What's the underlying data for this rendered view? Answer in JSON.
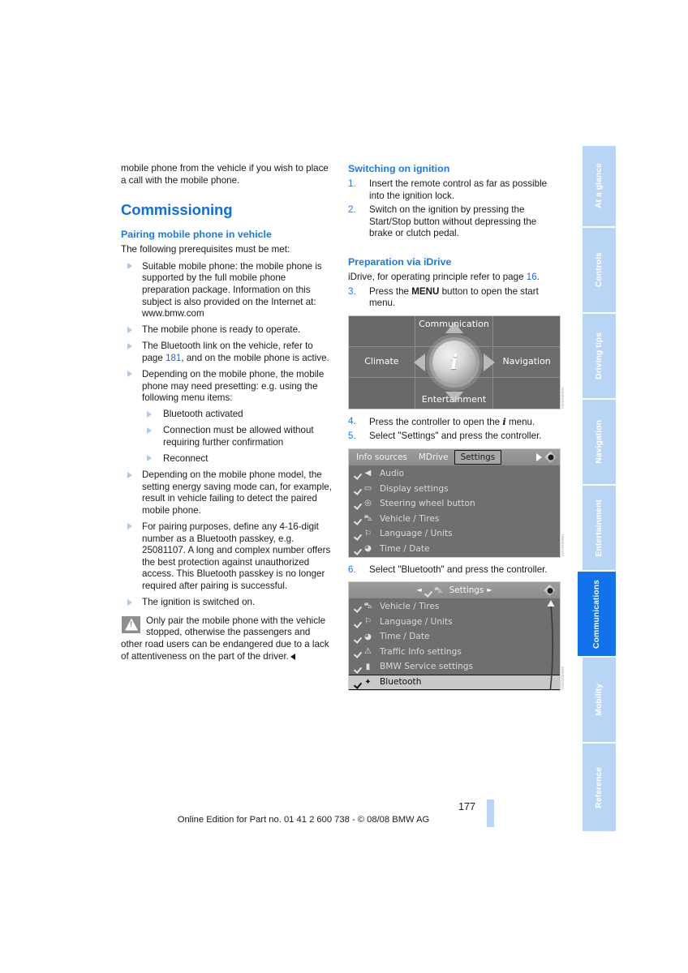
{
  "document": {
    "page_number": "177",
    "footer_note": "Online Edition for Part no. 01 41 2 600 738 - © 08/08 BMW AG"
  },
  "left_column": {
    "intro_paragraph": "mobile phone from the vehicle if you wish to place a call with the mobile phone.",
    "heading": "Commissioning",
    "subheading": "Pairing mobile phone in vehicle",
    "prereq_intro": "The following prerequisites must be met:",
    "bullets": [
      "Suitable mobile phone: the mobile phone is supported by the full mobile phone preparation package. Information on this subject is also provided on the Internet at: www.bmw.com",
      "The mobile phone is ready to operate.",
      "The Bluetooth link on the vehicle, refer to page 181, and on the mobile phone is active.",
      "Depending on the mobile phone, the mobile phone may need presetting: e.g. using the following menu items:",
      "Depending on the mobile phone model, the setting energy saving mode can, for example, result in vehicle failing to detect the paired mobile phone.",
      "For pairing purposes, define any 4-16-digit number as a Bluetooth passkey, e.g. 25081107. A long and complex number offers the best protection against unauthorized access. This Bluetooth passkey is no longer required after pairing is successful.",
      "The ignition is switched on."
    ],
    "bullet3_prefix": "The Bluetooth link on the vehicle, refer to",
    "bullet3_pagelabel": "page",
    "bullet3_pagenum": "181",
    "bullet3_suffix": ", and on the mobile phone is active.",
    "sub_bullets": [
      "Bluetooth activated",
      "Connection must be allowed without requiring further confirmation",
      "Reconnect"
    ],
    "warning": {
      "icon": "warning-triangle-icon",
      "text": "Only pair the mobile phone with the vehicle stopped, otherwise the passengers and other road users can be endangered due to a lack of attentiveness on the part of the driver."
    }
  },
  "right_column": {
    "heading_ignition": "Switching on ignition",
    "steps_ignition": [
      {
        "num": "1.",
        "text": "Insert the remote control as far as possible into the ignition lock."
      },
      {
        "num": "2.",
        "text": "Switch on the ignition by pressing the Start/Stop button without depressing the brake or clutch pedal."
      }
    ],
    "heading_idrive": "Preparation via iDrive",
    "idrive_intro_prefix": "iDrive, for operating principle refer to page",
    "idrive_intro_pagenum": "16",
    "idrive_intro_suffix": ".",
    "step3": {
      "num": "3.",
      "text_before": "Press the",
      "bold": "MENU",
      "text_after": "button to open the start menu."
    },
    "step4": {
      "num": "4.",
      "text_before": "Press the controller to open the",
      "icon": "i-menu-icon",
      "text_after": "menu."
    },
    "step5": {
      "num": "5.",
      "text": "Select \"Settings\" and press the controller."
    },
    "step6": {
      "num": "6.",
      "text": "Select \"Bluetooth\" and press the controller."
    }
  },
  "screenshots": {
    "start_menu": {
      "caption_code": "V3093Gb08A",
      "labels": {
        "top": "Communication",
        "left": "Climate",
        "right": "Navigation",
        "bottom": "Entertainment"
      },
      "center_icon": "i"
    },
    "settings_menu": {
      "caption_code": "V3102635B01",
      "tabs": [
        "Info sources",
        "MDrive",
        "Settings"
      ],
      "active_tab": "Settings",
      "items": [
        {
          "label": "Audio",
          "icon": "audio-icon"
        },
        {
          "label": "Display settings",
          "icon": "display-icon"
        },
        {
          "label": "Steering wheel button",
          "icon": "steering-wheel-icon"
        },
        {
          "label": "Vehicle / Tires",
          "icon": "vehicle-icon"
        },
        {
          "label": "Language / Units",
          "icon": "language-flag-icon"
        },
        {
          "label": "Time / Date",
          "icon": "clock-icon"
        }
      ]
    },
    "bluetooth_menu": {
      "caption_code": "V3092635B05",
      "title": "Settings",
      "title_icon": "vehicle-icon",
      "items": [
        {
          "label": "Vehicle / Tires",
          "icon": "vehicle-icon",
          "selected": false
        },
        {
          "label": "Language / Units",
          "icon": "language-flag-icon",
          "selected": false
        },
        {
          "label": "Time / Date",
          "icon": "clock-icon",
          "selected": false
        },
        {
          "label": "Traffic Info settings",
          "icon": "traffic-warning-icon",
          "selected": false
        },
        {
          "label": "BMW Service settings",
          "icon": "service-icon",
          "selected": false
        },
        {
          "label": "Bluetooth",
          "icon": "bluetooth-icon",
          "selected": true
        }
      ]
    }
  },
  "tabstrip": {
    "items": [
      {
        "label": "At a glance",
        "active": false
      },
      {
        "label": "Controls",
        "active": false
      },
      {
        "label": "Driving tips",
        "active": false
      },
      {
        "label": "Navigation",
        "active": false
      },
      {
        "label": "Entertainment",
        "active": false
      },
      {
        "label": "Communications",
        "active": true
      },
      {
        "label": "Mobility",
        "active": false
      },
      {
        "label": "Reference",
        "active": false
      }
    ]
  },
  "colors": {
    "accent_blue": "#0d6fe0",
    "tab_inactive": "#b9d5f5",
    "tab_active": "#1272ec",
    "link": "#2f5fd0"
  }
}
